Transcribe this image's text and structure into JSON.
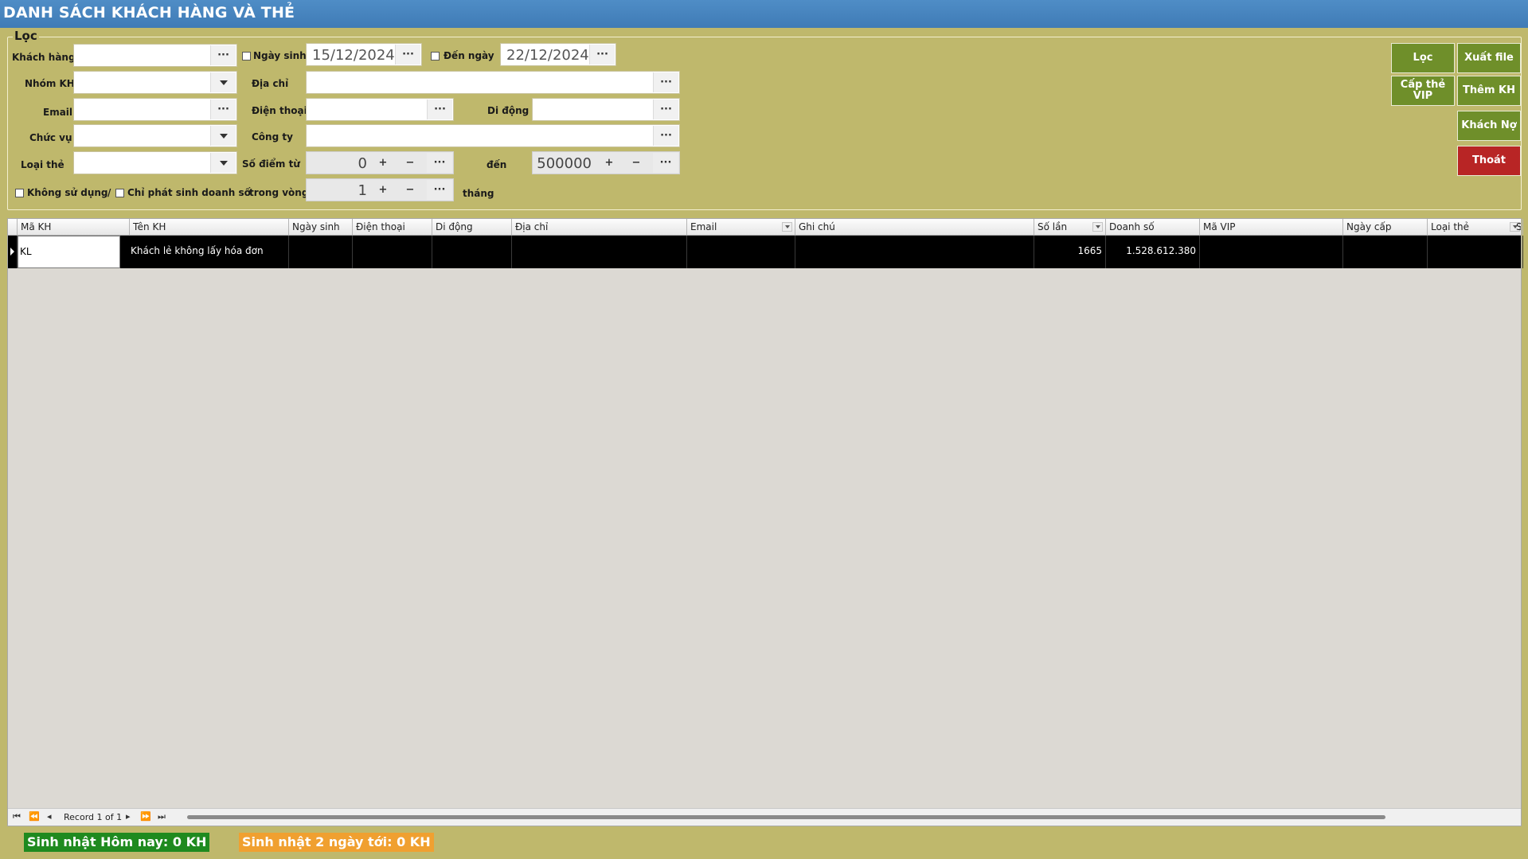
{
  "window": {
    "title": "DANH SÁCH KHÁCH HÀNG VÀ THẺ"
  },
  "filter": {
    "legend": "Lọc",
    "labels": {
      "customer": "Khách hàng",
      "group": "Nhóm KH",
      "email": "Email",
      "position": "Chức vụ",
      "card_type": "Loại thẻ",
      "birthday": "Ngày sinh",
      "to_date": "Đến ngày",
      "address": "Địa chỉ",
      "phone": "Điện thoại",
      "mobile": "Di động",
      "company": "Công ty",
      "points_from": "Số điểm từ",
      "points_to": "đến",
      "within": "trong vòng",
      "months": "tháng",
      "not_used": "Không sử dụng",
      "slash": "/",
      "only_sales": "Chỉ phát sinh doanh số"
    },
    "values": {
      "birthday_from": "15/12/2024",
      "birthday_to": "22/12/2024",
      "points_from": "0",
      "points_to": "500000",
      "within_months": "1"
    },
    "symbols": {
      "ellipsis": "···",
      "plus": "+",
      "minus": "−"
    }
  },
  "actions": {
    "filter": "Lọc",
    "export": "Xuất file",
    "issue_vip": "Cấp thẻ VIP",
    "add_customer": "Thêm KH",
    "debtors": "Khách Nợ",
    "exit": "Thoát"
  },
  "grid": {
    "columns": [
      "Mã KH",
      "Tên KH",
      "Ngày sinh",
      "Điện thoại",
      "Di động",
      "Địa chỉ",
      "Email",
      "Ghi chú",
      "Số lần",
      "Doanh số",
      "Mã VIP",
      "Ngày cấp",
      "Loại thẻ",
      "S"
    ],
    "rows": [
      {
        "ma_kh": "KL",
        "ten_kh": "Khách lẻ không lấy hóa đơn",
        "so_lan": "1665",
        "doanh_so": "1.528.612.380"
      }
    ],
    "navigator": {
      "record": "Record 1 of 1"
    }
  },
  "status": {
    "today": "Sinh nhật Hôm nay: 0 KH",
    "next2": "Sinh nhật 2 ngày tới: 0 KH"
  },
  "colors": {
    "title_bar": "#4384be",
    "background": "#bfb86c",
    "action_green": "#6f8f2a",
    "action_red": "#b82525",
    "status_green": "#1f8a1f",
    "status_orange": "#f0a030"
  }
}
